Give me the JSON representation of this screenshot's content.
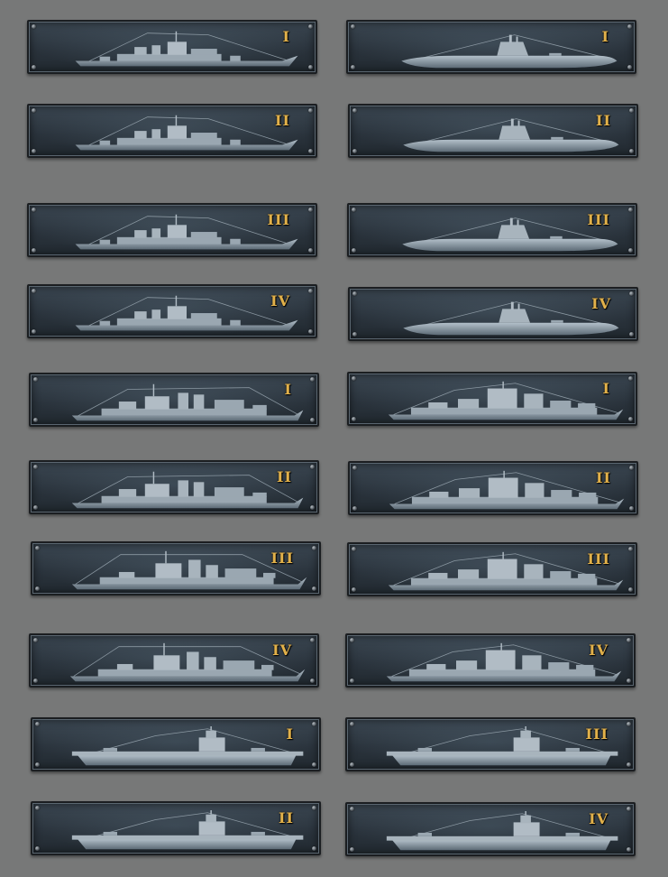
{
  "cards": [
    {
      "tier": "I",
      "ship_icon": "destroyer-icon"
    },
    {
      "tier": "I",
      "ship_icon": "submarine-icon"
    },
    {
      "tier": "II",
      "ship_icon": "destroyer-icon"
    },
    {
      "tier": "II",
      "ship_icon": "submarine-icon"
    },
    {
      "tier": "III",
      "ship_icon": "destroyer-icon"
    },
    {
      "tier": "III",
      "ship_icon": "submarine-icon"
    },
    {
      "tier": "IV",
      "ship_icon": "destroyer-icon"
    },
    {
      "tier": "IV",
      "ship_icon": "submarine-icon"
    },
    {
      "tier": "I",
      "ship_icon": "light-cruiser-icon"
    },
    {
      "tier": "I",
      "ship_icon": "battleship-icon"
    },
    {
      "tier": "II",
      "ship_icon": "light-cruiser-icon"
    },
    {
      "tier": "II",
      "ship_icon": "battleship-icon"
    },
    {
      "tier": "III",
      "ship_icon": "heavy-cruiser-icon"
    },
    {
      "tier": "III",
      "ship_icon": "battleship-icon"
    },
    {
      "tier": "IV",
      "ship_icon": "heavy-cruiser-icon"
    },
    {
      "tier": "IV",
      "ship_icon": "battleship-icon"
    },
    {
      "tier": "I",
      "ship_icon": "carrier-icon"
    },
    {
      "tier": "III",
      "ship_icon": "carrier-icon"
    },
    {
      "tier": "II",
      "ship_icon": "carrier-icon"
    },
    {
      "tier": "IV",
      "ship_icon": "carrier-icon"
    }
  ],
  "colors": {
    "background": "#777878",
    "tier_text": "#e2b14a",
    "plate": "#2a333c",
    "ship": "#8f9da8"
  }
}
